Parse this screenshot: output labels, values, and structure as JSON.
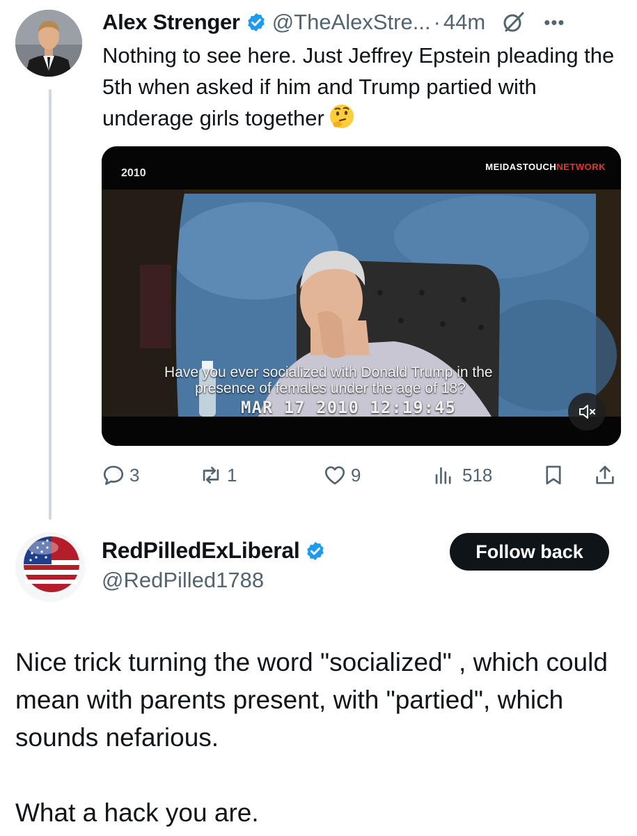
{
  "parent_tweet": {
    "author_name": "Alex Strenger",
    "handle": "@TheAlexStre...",
    "separator": "·",
    "time": "44m",
    "text": "Nothing to see here.  Just Jeffrey Epstein pleading the 5th when asked if him and Trump partied with underage girls together",
    "video": {
      "year_label": "2010",
      "brand_primary": "MEIDASTOUCH",
      "brand_accent": "NETWORK",
      "subtitle_line1": "Have you ever socialized with Donald Trump in the",
      "subtitle_line2": "presence of females under the age of 18?",
      "timestamp": "MAR 17 2010  12:19:45"
    },
    "stats": {
      "replies": "3",
      "reposts": "1",
      "likes": "9",
      "views": "518"
    },
    "icons": [
      "verified-badge-icon",
      "grok-icon",
      "more-icon",
      "thinking-face-emoji",
      "mute-icon",
      "reply-icon",
      "repost-icon",
      "like-icon",
      "views-icon",
      "bookmark-icon",
      "share-icon"
    ]
  },
  "reply_user": {
    "name": "RedPilledExLiberal",
    "handle": "@RedPilled1788",
    "follow_label": "Follow back",
    "text_p1": "Nice trick turning the word \"socialized\" , which could mean with parents present, with \"partied\", which sounds nefarious.",
    "text_p2": "What a hack you are."
  },
  "colors": {
    "verified_blue": "#1d9bf0",
    "secondary_text": "#536471",
    "button_dark": "#0f1419",
    "brand_red": "#e3342f"
  }
}
